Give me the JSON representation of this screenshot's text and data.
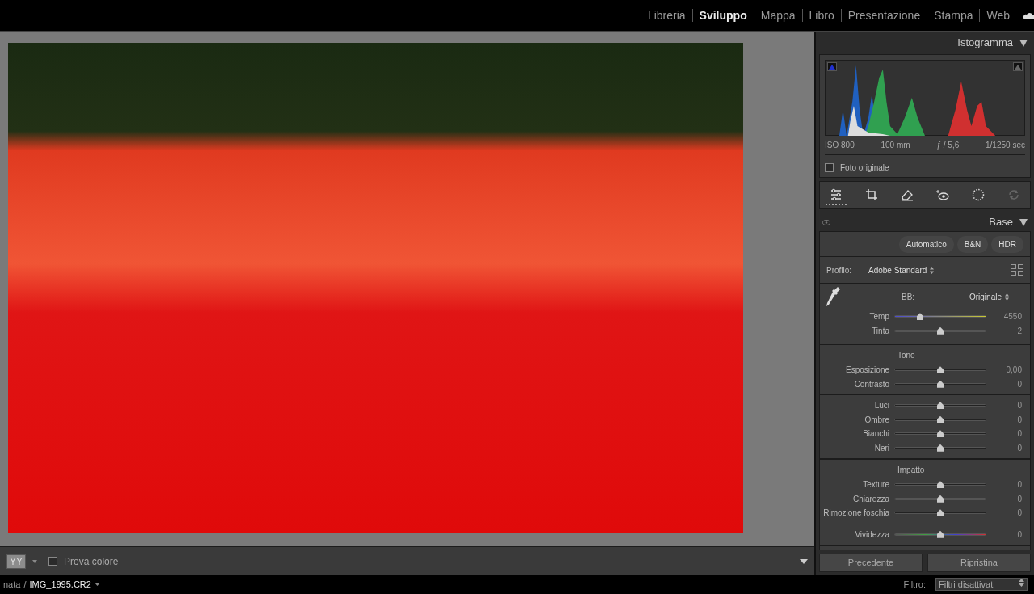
{
  "modules": [
    {
      "label": "Libreria",
      "selected": false
    },
    {
      "label": "Sviluppo",
      "selected": true
    },
    {
      "label": "Mappa",
      "selected": false
    },
    {
      "label": "Libro",
      "selected": false
    },
    {
      "label": "Presentazione",
      "selected": false
    },
    {
      "label": "Stampa",
      "selected": false
    },
    {
      "label": "Web",
      "selected": false
    }
  ],
  "toolbar": {
    "compare_glyphs": [
      "Y",
      "Y"
    ],
    "soft_proof": {
      "label": "Prova colore",
      "checked": false
    }
  },
  "filmstrip": {
    "path": "nata",
    "separator": "/",
    "file": "IMG_1995.CR2",
    "filter_label": "Filtro:",
    "filter_value": "Filtri disattivati"
  },
  "histogram": {
    "title": "Istogramma",
    "exif": [
      "ISO 800",
      "100 mm",
      "ƒ / 5,6",
      "1/1250 sec"
    ],
    "original_photo": {
      "label": "Foto originale",
      "checked": false
    }
  },
  "tools": [
    {
      "kind": "sliders",
      "selected": true,
      "disabled": false
    },
    {
      "kind": "crop",
      "selected": false,
      "disabled": false
    },
    {
      "kind": "eraser",
      "selected": false,
      "disabled": false
    },
    {
      "kind": "redeye",
      "selected": false,
      "disabled": false
    },
    {
      "kind": "mask",
      "selected": false,
      "disabled": false
    },
    {
      "kind": "sync",
      "selected": false,
      "disabled": true
    }
  ],
  "base": {
    "title": "Base",
    "presets": [
      "Automatico",
      "B&N",
      "HDR"
    ],
    "profile_label": "Profilo:",
    "profile_value": "Adobe Standard",
    "wb_label": "BB:",
    "wb_value": "Originale",
    "wb_sliders": [
      {
        "label": "Temp",
        "kind": "temp",
        "level": 0.28,
        "reading": "4550"
      },
      {
        "label": "Tinta",
        "kind": "tint",
        "level": 0.5,
        "reading": "− 2"
      }
    ],
    "sections": [
      {
        "title": "Tono",
        "sliders": [
          {
            "label": "Esposizione",
            "kind": "plain",
            "level": 0.5,
            "reading": "0,00"
          },
          {
            "label": "Contrasto",
            "kind": "plain",
            "level": 0.5,
            "reading": "0"
          }
        ]
      },
      {
        "sliders": [
          {
            "label": "Luci",
            "kind": "plain",
            "level": 0.5,
            "reading": "0"
          },
          {
            "label": "Ombre",
            "kind": "plain",
            "level": 0.5,
            "reading": "0"
          },
          {
            "label": "Bianchi",
            "kind": "plain",
            "level": 0.5,
            "reading": "0"
          },
          {
            "label": "Neri",
            "kind": "plain",
            "level": 0.5,
            "reading": "0"
          }
        ]
      },
      {
        "title": "Impatto",
        "sliders": [
          {
            "label": "Texture",
            "kind": "plain",
            "level": 0.5,
            "reading": "0"
          },
          {
            "label": "Chiarezza",
            "kind": "plain",
            "level": 0.5,
            "reading": "0"
          },
          {
            "label": "Rimozione foschia",
            "kind": "plain",
            "level": 0.5,
            "reading": "0"
          }
        ]
      },
      {
        "sliders": [
          {
            "label": "Vividezza",
            "kind": "vivid",
            "level": 0.5,
            "reading": "0"
          }
        ]
      }
    ]
  },
  "footer_buttons": [
    "Precedente",
    "Ripristina"
  ]
}
